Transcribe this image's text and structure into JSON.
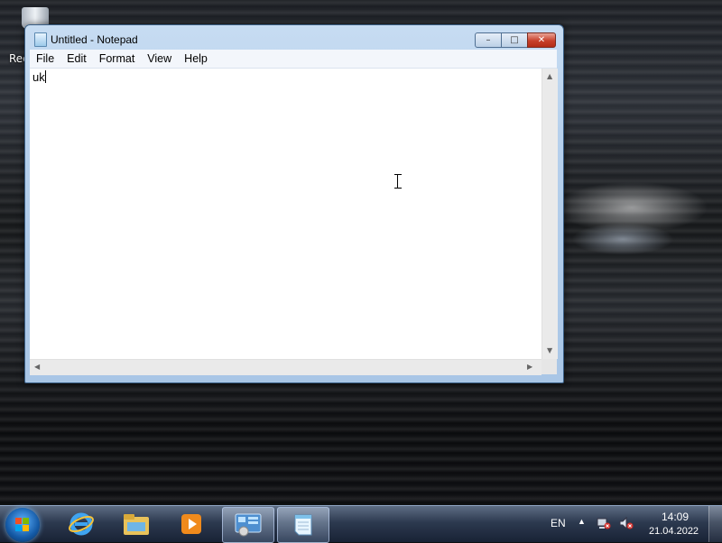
{
  "desktop": {
    "icons": [
      {
        "label": "Rec",
        "name": "recycle-bin"
      }
    ]
  },
  "window": {
    "title": "Untitled - Notepad",
    "menu": [
      "File",
      "Edit",
      "Format",
      "View",
      "Help"
    ],
    "content": "uk",
    "caption_buttons": {
      "minimize": "–",
      "maximize": "□",
      "close": "✕"
    }
  },
  "taskbar": {
    "pinned": [
      "internet-explorer",
      "windows-explorer",
      "media-player",
      "control-panel",
      "notepad"
    ],
    "language": "EN",
    "time": "14:09",
    "date": "21.04.2022"
  }
}
